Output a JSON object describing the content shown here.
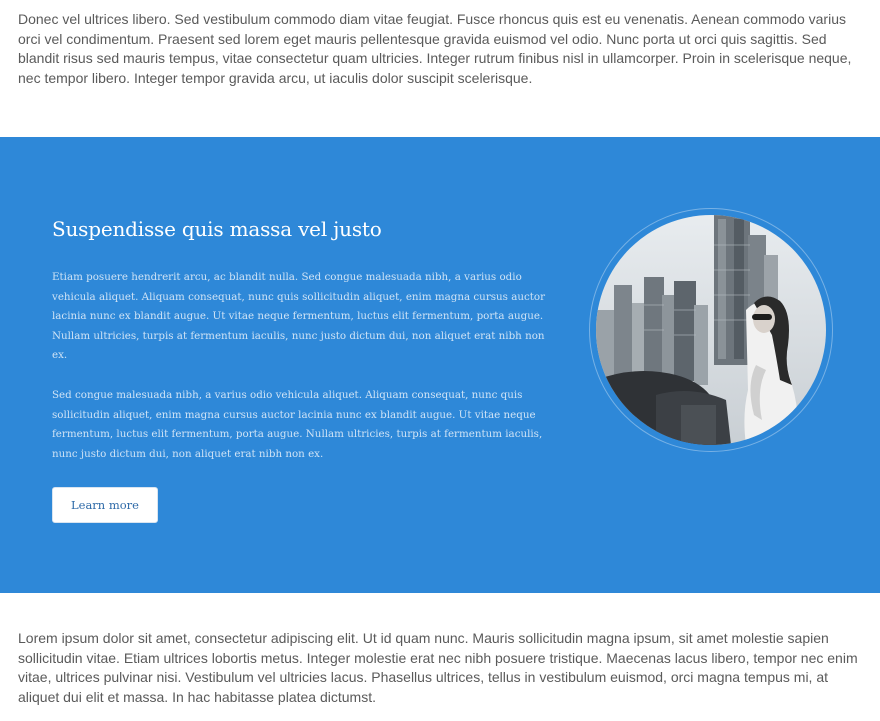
{
  "intro": {
    "paragraph": "Donec vel ultrices libero. Sed vestibulum commodo diam vitae feugiat. Fusce rhoncus quis est eu venenatis. Aenean commodo varius orci vel condimentum. Praesent sed lorem eget mauris pellentesque gravida euismod vel odio. Nunc porta ut orci quis sagittis. Sed blandit risus sed mauris tempus, vitae consectetur quam ultricies. Integer rutrum finibus nisl in ullamcorper. Proin in scelerisque neque, nec tempor libero. Integer tempor gravida arcu, ut iaculis dolor suscipit scelerisque."
  },
  "feature": {
    "title": "Suspendisse quis massa vel justo",
    "paragraph_1": "Etiam posuere hendrerit arcu, ac blandit nulla. Sed congue malesuada nibh, a varius odio vehicula aliquet. Aliquam consequat, nunc quis sollicitudin aliquet, enim magna cursus auctor lacinia nunc ex blandit augue. Ut vitae neque fermentum, luctus elit fermentum, porta augue. Nullam ultricies, turpis at fermentum iaculis, nunc justo dictum dui, non aliquet erat nibh non ex.",
    "paragraph_2": "Sed congue malesuada nibh, a varius odio vehicula aliquet. Aliquam consequat, nunc quis sollicitudin aliquet, enim magna cursus auctor lacinia nunc ex blandit augue. Ut vitae neque fermentum, luctus elit fermentum, porta augue. Nullam ultricies, turpis at fermentum iaculis, nunc justo dictum dui, non aliquet erat nibh non ex.",
    "button_label": "Learn more",
    "image_description": "City skyline with a woman wearing sunglasses, circular crop",
    "background_color": "#2e88d8"
  },
  "outro": {
    "paragraph": "Lorem ipsum dolor sit amet, consectetur adipiscing elit. Ut id quam nunc. Mauris sollicitudin magna ipsum, sit amet molestie sapien sollicitudin vitae. Etiam ultrices lobortis metus. Integer molestie erat nec nibh posuere tristique. Maecenas lacus libero, tempor nec enim vitae, ultrices pulvinar nisi. Vestibulum vel ultricies lacus. Phasellus ultrices, tellus in vestibulum euismod, orci magna tempus mi, at aliquet dui elit et massa. In hac habitasse platea dictumst."
  }
}
